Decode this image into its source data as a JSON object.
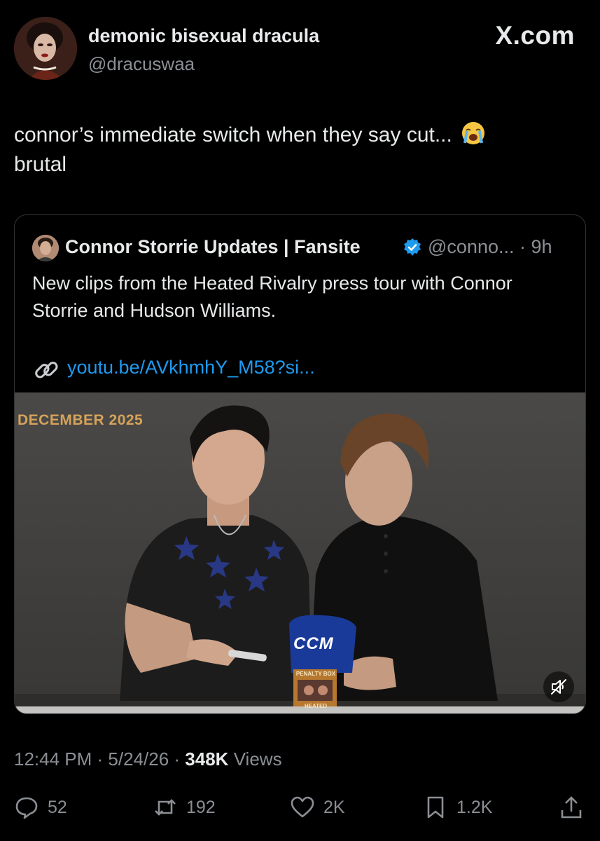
{
  "author": {
    "display_name": "demonic bisexual dracula",
    "handle": "@dracuswaa"
  },
  "brand": "X.com",
  "tweet": {
    "text": "connor’s immediate switch when they say cut...",
    "text_line2": "brutal",
    "emoji": "loudly-crying-face"
  },
  "quote": {
    "name": "Connor Storrie Updates | Fansite",
    "handle_time": "@conno... · 9h",
    "text": "New clips from the Heated Rivalry press tour with Connor Storrie and Hudson Williams.",
    "link": "youtu.be/AVkhmhY_M58?si...",
    "video": {
      "overlay_label": "DECEMBER 2025",
      "glove_brand": "CCM",
      "box_label": "PENALTY BOX",
      "box_sub": "HEATED"
    }
  },
  "meta": {
    "time": "12:44 PM",
    "date": "5/24/26",
    "views_count": "348K",
    "views_label": "Views"
  },
  "actions": {
    "replies": "52",
    "reposts": "192",
    "likes": "2K",
    "bookmarks": "1.2K"
  },
  "colors": {
    "background": "#000000",
    "text": "#e7e9ea",
    "secondary": "#8b8f94",
    "link": "#1d9bf0",
    "verified": "#1d9bf0",
    "video_label": "#d6a25a"
  }
}
